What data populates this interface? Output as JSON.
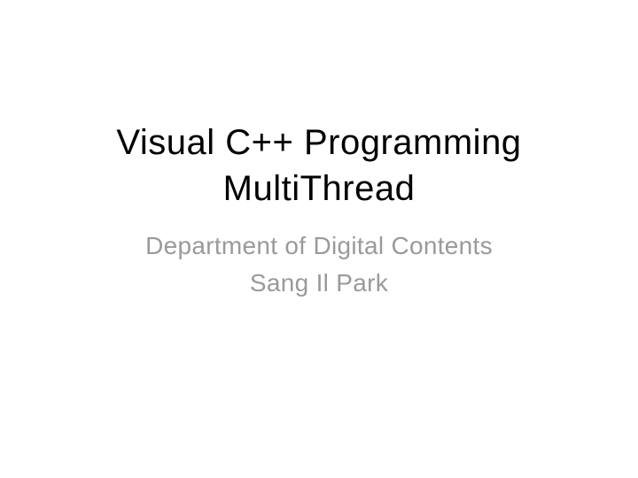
{
  "title_line1": "Visual C++ Programming",
  "title_line2": "MultiThread",
  "subtitle_line1": "Department of Digital Contents",
  "subtitle_line2": "Sang Il Park"
}
